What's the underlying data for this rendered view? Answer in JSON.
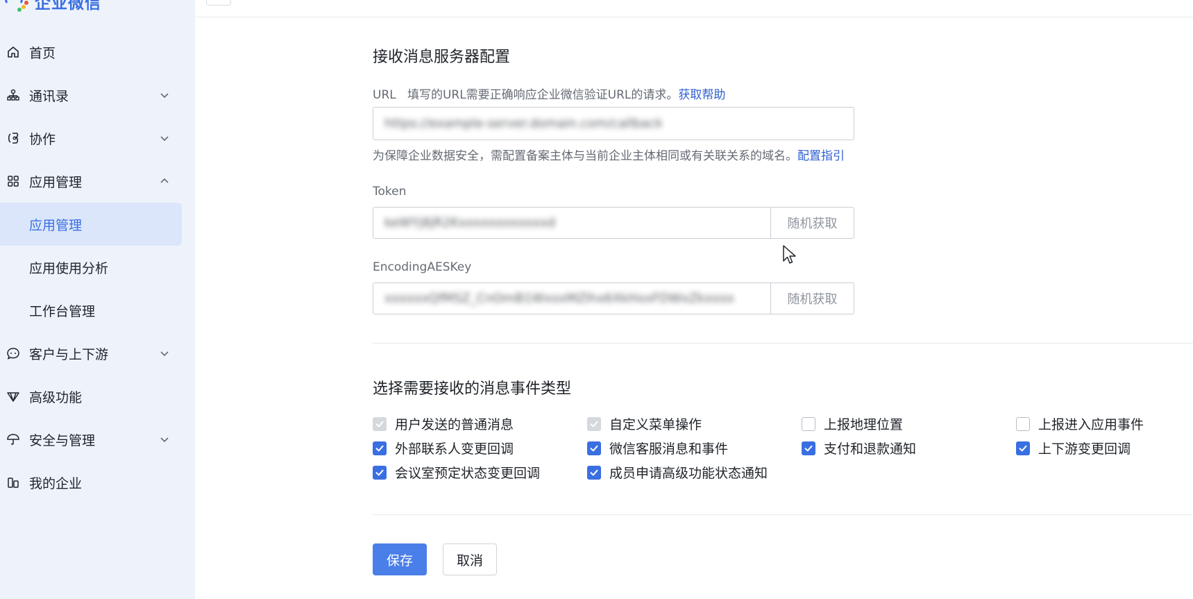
{
  "brand": {
    "name": "企业微信"
  },
  "sidebar": {
    "items": [
      {
        "label": "首页",
        "icon": "home-icon"
      },
      {
        "label": "通讯录",
        "icon": "org-chart-icon",
        "chevron": "down"
      },
      {
        "label": "协作",
        "icon": "collab-icon",
        "chevron": "down"
      },
      {
        "label": "应用管理",
        "icon": "grid-icon",
        "chevron": "up"
      },
      {
        "label": "应用管理",
        "sub": true,
        "active": true
      },
      {
        "label": "应用使用分析",
        "sub": true
      },
      {
        "label": "工作台管理",
        "sub": true
      },
      {
        "label": "客户与上下游",
        "icon": "chat-bubble-icon",
        "chevron": "down"
      },
      {
        "label": "高级功能",
        "icon": "diamond-icon"
      },
      {
        "label": "安全与管理",
        "icon": "umbrella-icon",
        "chevron": "down"
      },
      {
        "label": "我的企业",
        "icon": "building-icon"
      }
    ]
  },
  "server_config": {
    "title": "接收消息服务器配置",
    "url_label": "URL",
    "url_desc": "填写的URL需要正确响应企业微信验证URL的请求。",
    "url_help": "获取帮助",
    "url_value": "https://example-server.domain.com/callback",
    "url_hint": "为保障企业数据安全，需配置备案主体与当前企业主体相同或有关联关系的域名。",
    "url_hint_link": "配置指引",
    "token_label": "Token",
    "token_value": "keWYj8jR2Kxxxxxxxxxxxxd",
    "token_btn": "随机获取",
    "aes_label": "EncodingAESKey",
    "aes_value": "xxxxxxQfMSZ_CnOmB1WxxxMZlhx6XkHxxFDWxZkxxxx",
    "aes_btn": "随机获取"
  },
  "events": {
    "title": "选择需要接收的消息事件类型",
    "options": [
      {
        "label": "用户发送的普通消息",
        "state": "disabled"
      },
      {
        "label": "自定义菜单操作",
        "state": "disabled"
      },
      {
        "label": "上报地理位置",
        "state": "unchecked"
      },
      {
        "label": "上报进入应用事件",
        "state": "unchecked"
      },
      {
        "label": "外部联系人变更回调",
        "state": "checked"
      },
      {
        "label": "微信客服消息和事件",
        "state": "checked"
      },
      {
        "label": "支付和退款通知",
        "state": "checked"
      },
      {
        "label": "上下游变更回调",
        "state": "checked"
      },
      {
        "label": "会议室预定状态变更回调",
        "state": "checked"
      },
      {
        "label": "成员申请高级功能状态通知",
        "state": "checked"
      }
    ]
  },
  "actions": {
    "save": "保存",
    "cancel": "取消"
  },
  "colors": {
    "accent": "#3a6fe2",
    "sidebar_bg": "#eef3fb",
    "active_bg": "#dbe6fb",
    "link": "#2f5fcf"
  }
}
